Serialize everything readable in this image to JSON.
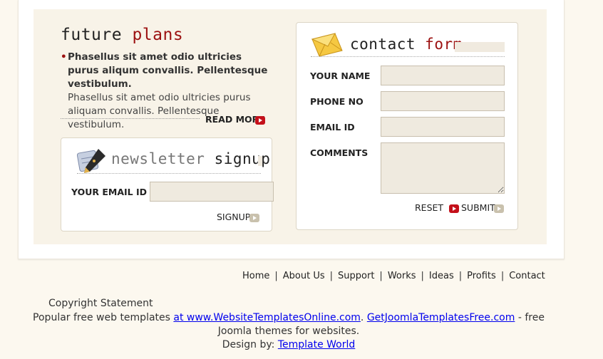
{
  "future": {
    "title_plain": "future",
    "title_accent": "plans",
    "bullet_bold": "Phasellus sit amet odio ultricies purus aliqum convallis. Pellentesque vestibulum.",
    "bullet_text": "Phasellus sit amet odio ultricies purus aliquam convallis. Pellentesque vestibulum.",
    "read_more": "READ MORE"
  },
  "newsletter": {
    "title_plain": "newsletter",
    "title_accent": "signup",
    "email_label": "YOUR EMAIL ID",
    "email_value": "",
    "signup_label": "SIGNUP"
  },
  "contact": {
    "title_plain": "contact",
    "title_accent": "form",
    "name_label": "YOUR NAME",
    "phone_label": "PHONE NO",
    "email_label": "EMAIL ID",
    "comments_label": "COMMENTS",
    "reset_label": "RESET",
    "submit_label": "SUBMIT"
  },
  "footer": {
    "nav": [
      "Home",
      "About Us",
      "Support",
      "Works",
      "Ideas",
      "Profits",
      "Contact"
    ],
    "copyright": "Copyright Statement",
    "line1_prefix": "Popular free web templates ",
    "link1": "at www.WebsiteTemplatesOnline.com",
    "line1_mid": ". ",
    "link2": "GetJoomlaTemplatesFree.com",
    "line1_suffix": " - free Joomla themes for websites.",
    "design_prefix": "Design by: ",
    "design_link": "Template World"
  },
  "colors": {
    "accent": "#9c1111",
    "panel": "#f8f3e8",
    "field": "#efeadf",
    "background": "#fcf8ef"
  }
}
